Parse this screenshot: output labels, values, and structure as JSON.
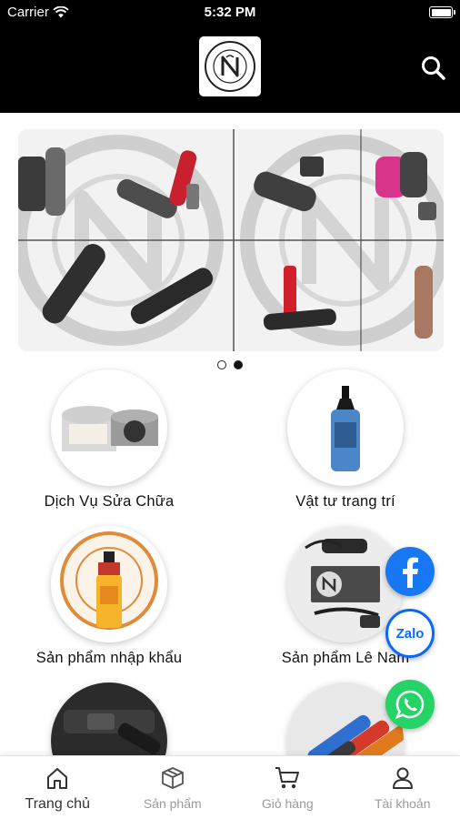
{
  "status_bar": {
    "carrier": "Carrier",
    "time": "5:32 PM"
  },
  "header": {
    "logo_icon": "brand-logo",
    "search_icon": "search-icon"
  },
  "banner": {
    "slides": 2,
    "active_slide": 2
  },
  "categories": [
    {
      "label": "Dịch Vụ Sửa Chữa"
    },
    {
      "label": "Vật tư trang trí"
    },
    {
      "label": "Sản phẩm nhập khẩu"
    },
    {
      "label": "Sản phẩm Lê Nam"
    },
    {
      "label": ""
    },
    {
      "label": ""
    }
  ],
  "floating": {
    "facebook_icon": "facebook-icon",
    "zalo_label": "Zalo",
    "whatsapp_icon": "whatsapp-icon"
  },
  "bottom_nav": [
    {
      "label": "Trang chủ",
      "icon": "home-icon",
      "active": true
    },
    {
      "label": "Sản phẩm",
      "icon": "box-icon",
      "active": false
    },
    {
      "label": "Giỏ hàng",
      "icon": "cart-icon",
      "active": false
    },
    {
      "label": "Tài khoản",
      "icon": "user-icon",
      "active": false
    }
  ],
  "colors": {
    "header_bg": "#000000",
    "facebook": "#1877f2",
    "zalo": "#0a68ff",
    "whatsapp": "#25d366"
  }
}
